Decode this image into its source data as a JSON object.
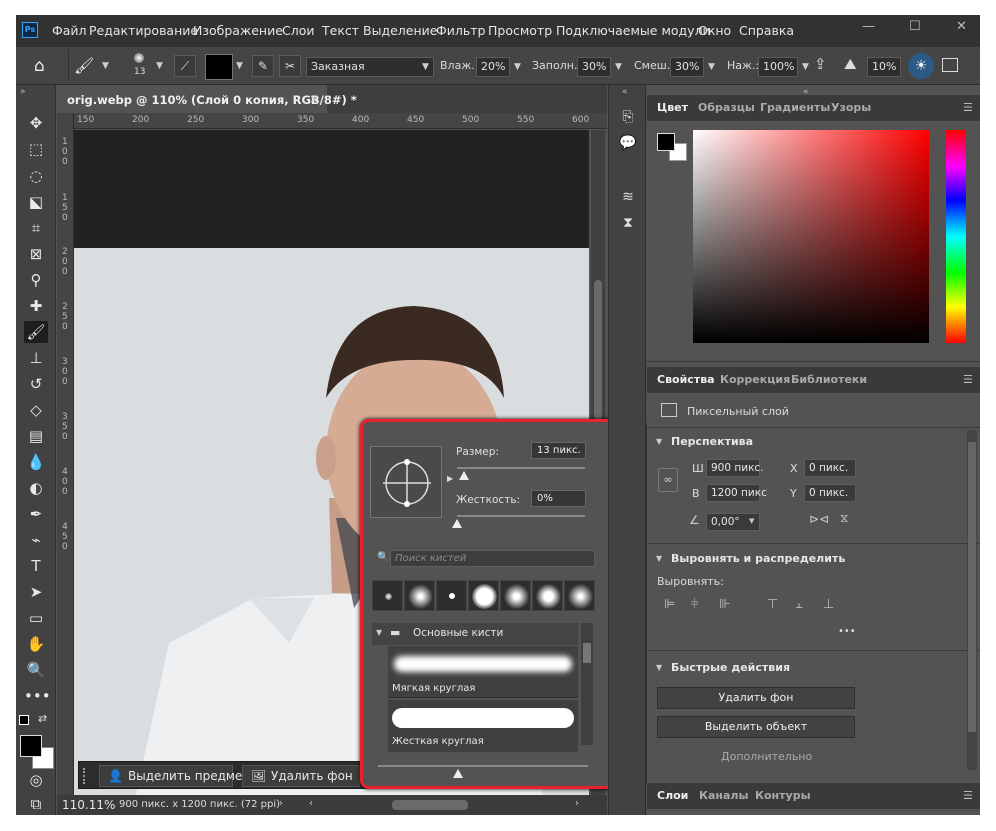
{
  "menubar": {
    "app_icon": "Ps",
    "items": [
      "Файл",
      "Редактирование",
      "Изображение",
      "Слои",
      "Текст",
      "Выделение",
      "Фильтр",
      "Просмотр",
      "Подключаемые модули",
      "Окно",
      "Справка"
    ]
  },
  "options": {
    "brush_size_label": "13",
    "mode_value": "Заказная",
    "wet_label": "Влаж.:",
    "wet_value": "20%",
    "load_label": "Заполн.:",
    "load_value": "30%",
    "mix_label": "Смеш.:",
    "mix_value": "30%",
    "flow_label": "Наж.:",
    "flow_value": "100%",
    "angle_value": "10%"
  },
  "document": {
    "tab_title": "orig.webp @ 110% (Слой 0 копия, RGB/8#) *",
    "close_glyph": "×",
    "ruler_top": [
      "150",
      "200",
      "250",
      "300",
      "350",
      "400",
      "450",
      "500",
      "550",
      "600"
    ],
    "ruler_left": [
      "1",
      "0",
      "0",
      "1",
      "5",
      "0",
      "2",
      "0",
      "0",
      "2",
      "5",
      "0",
      "3",
      "0",
      "0",
      "3",
      "5",
      "0",
      "4",
      "0",
      "0",
      "4",
      "5",
      "0"
    ],
    "zoom": "110.11%",
    "status_info": "900 пикс. x 1200 пикс. (72 ppi)"
  },
  "taskbar": {
    "select_subject": "Выделить предмет",
    "remove_bg": "Удалить фон"
  },
  "brush_popup": {
    "size_label": "Размер:",
    "size_value": "13 пикс.",
    "hardness_label": "Жесткость:",
    "hardness_value": "0%",
    "search_placeholder": "Поиск кистей",
    "folder_name": "Основные кисти",
    "brushes": [
      "Мягкая круглая",
      "Жесткая круглая"
    ]
  },
  "color_panel": {
    "tabs": [
      "Цвет",
      "Образцы",
      "Градиенты",
      "Узоры"
    ],
    "hue_color": "#ff0000"
  },
  "properties": {
    "tabs": [
      "Свойства",
      "Коррекция",
      "Библиотеки"
    ],
    "layer_type": "Пиксельный слой",
    "transform_head": "Перспектива",
    "w_label": "Ш",
    "w_value": "900 пикс.",
    "h_label": "В",
    "h_value": "1200 пикс",
    "x_label": "X",
    "x_value": "0 пикс.",
    "y_label": "Y",
    "y_value": "0 пикс.",
    "angle_value": "0,00°",
    "align_head": "Выровнять и распределить",
    "align_sub": "Выровнять:",
    "more_glyph": "•••",
    "quick_head": "Быстрые действия",
    "btn_remove_bg": "Удалить фон",
    "btn_select_subject": "Выделить объект",
    "more_actions": "Дополнительно"
  },
  "layers_tabs": [
    "Слои",
    "Каналы",
    "Контуры"
  ]
}
